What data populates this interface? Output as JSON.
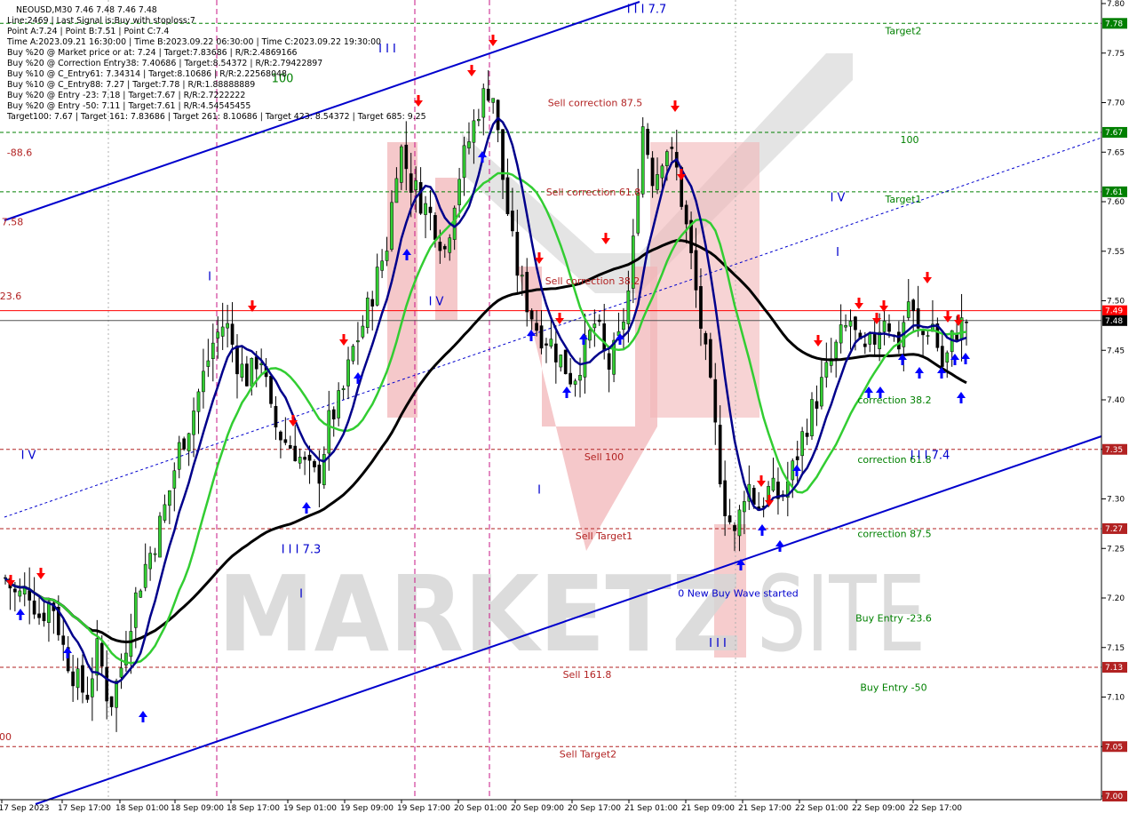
{
  "header": {
    "symbol_line": "NEOUSD,M30  7.46 7.48 7.46 7.48",
    "info_lines": [
      "Line:2469 | Last Signal is:Buy with stoploss:7",
      "Point A:7.24 | Point B:7.51 | Point C:7.4",
      "Time A:2023.09.21 16:30:00 | Time B:2023.09.22 06:30:00 | Time C:2023.09.22 19:30:00",
      "Buy %20 @ Market price or at: 7.24 | Target:7.83686 | R/R:2.4869166",
      "Buy %20 @ Correction Entry38: 7.40686 | Target:8.54372 | R/R:2.79422897",
      "Buy %10 @ C_Entry61: 7.34314 | Target:8.10686 | R/R:2.22568048",
      "Buy %10 @ C_Entry88: 7.27 | Target:7.78 | R/R:1.88888889",
      "Buy %20 @ Entry -23: 7.18 | Target:7.67 | R/R:2.7222222",
      "Buy %20 @ Entry -50: 7.11 | Target:7.61 | R/R:4.54545455",
      "Target100: 7.67 | Target 161: 7.83686 | Target 261: 8.10686 | Target 423: 8.54372 | Target 685: 9.25"
    ]
  },
  "watermark": {
    "text": "MARKETZ",
    "text2": "SITE"
  },
  "colors": {
    "buy": "#0000ff",
    "sell": "#ff0000",
    "green_level": "#008000",
    "red_level": "#b22222",
    "ma_fast": "#00008b",
    "ma_mid": "#32cd32",
    "ma_slow": "#000000",
    "price_tag": "#ff0000",
    "channel": "#0000cd"
  },
  "chart_data": {
    "type": "candlestick",
    "symbol": "NEOUSD",
    "timeframe": "M30",
    "ylim": [
      7.0,
      7.8
    ],
    "x_labels": [
      "17 Sep 2023",
      "17 Sep 17:00",
      "18 Sep 01:00",
      "18 Sep 09:00",
      "18 Sep 17:00",
      "19 Sep 01:00",
      "19 Sep 09:00",
      "19 Sep 17:00",
      "20 Sep 01:00",
      "20 Sep 09:00",
      "20 Sep 17:00",
      "21 Sep 01:00",
      "21 Sep 09:00",
      "21 Sep 17:00",
      "22 Sep 01:00",
      "22 Sep 09:00",
      "22 Sep 17:00"
    ],
    "y_ticks": [
      "7.80",
      "7.75",
      "7.70",
      "7.65",
      "7.60",
      "7.55",
      "7.50",
      "7.45",
      "7.40",
      "7.35",
      "7.30",
      "7.25",
      "7.20",
      "7.15",
      "7.10",
      "7.05",
      "7.00"
    ],
    "price_tags": [
      {
        "text": "7.78",
        "price": 7.78,
        "color": "#008000"
      },
      {
        "text": "7.67",
        "price": 7.67,
        "color": "#008000"
      },
      {
        "text": "7.61",
        "price": 7.61,
        "color": "#008000"
      },
      {
        "text": "7.49",
        "price": 7.49,
        "color": "#ff0000"
      },
      {
        "text": "7.48",
        "price": 7.48,
        "color": "#000000"
      },
      {
        "text": "7.35",
        "price": 7.35,
        "color": "#b22222"
      },
      {
        "text": "7.27",
        "price": 7.27,
        "color": "#b22222"
      },
      {
        "text": "7.13",
        "price": 7.13,
        "color": "#b22222"
      },
      {
        "text": "7.05",
        "price": 7.05,
        "color": "#b22222"
      },
      {
        "text": "7.00",
        "price": 7.0,
        "color": "#b22222"
      }
    ],
    "levels": [
      {
        "price": 7.78,
        "color": "#008000",
        "label": "Target2"
      },
      {
        "price": 7.67,
        "color": "#008000",
        "label": "100"
      },
      {
        "price": 7.61,
        "color": "#008000",
        "label": "Target1"
      },
      {
        "price": 7.35,
        "color": "#b22222",
        "label": "Sell 100"
      },
      {
        "price": 7.27,
        "color": "#b22222",
        "label": "Sell Target1"
      },
      {
        "price": 7.13,
        "color": "#b22222",
        "label": "Sell 161.8"
      },
      {
        "price": 7.05,
        "color": "#b22222",
        "label": "Sell Target2"
      }
    ],
    "level_texts": [
      {
        "text": "Sell correction 87.5",
        "price": 7.7,
        "color": "#b22222"
      },
      {
        "text": "Sell correction 61.8",
        "price": 7.61,
        "color": "#b22222"
      },
      {
        "text": "Sell correction 38.2",
        "price": 7.52,
        "color": "#b22222"
      },
      {
        "text": "correction 38.2",
        "price": 7.4,
        "color": "#008000"
      },
      {
        "text": "correction 61.8",
        "price": 7.34,
        "color": "#008000"
      },
      {
        "text": "correction 87.5",
        "price": 7.265,
        "color": "#008000"
      },
      {
        "text": "Buy Entry -23.6",
        "price": 7.18,
        "color": "#008000"
      },
      {
        "text": "Buy Entry -50",
        "price": 7.11,
        "color": "#008000"
      },
      {
        "text": "0 New Buy Wave started",
        "price": 7.205,
        "color": "#0000cd"
      },
      {
        "text": "-88.6",
        "price": 7.65,
        "color": "#b22222"
      },
      {
        "text": "7.58",
        "price": 7.58,
        "color": "#b22222"
      },
      {
        "text": "23.6",
        "price": 7.505,
        "color": "#b22222"
      },
      {
        "text": "00",
        "price": 7.06,
        "color": "#b22222"
      }
    ],
    "wave_labels": [
      {
        "text": "I I I",
        "price": 7.755
      },
      {
        "text": "I V",
        "price": 7.605
      },
      {
        "text": "I",
        "price": 7.55
      },
      {
        "text": "I",
        "price": 7.525
      },
      {
        "text": "I V",
        "price": 7.5
      },
      {
        "text": "I V",
        "price": 7.345
      },
      {
        "text": "I I I 7.4",
        "price": 7.345
      },
      {
        "text": "I I I 7.3",
        "price": 7.25
      },
      {
        "text": "I",
        "price": 7.31
      },
      {
        "text": "I",
        "price": 7.205
      },
      {
        "text": "I I I",
        "price": 7.155
      },
      {
        "text": "I I I 7.7",
        "price": 7.795
      },
      {
        "text": "100",
        "price": 7.725
      }
    ],
    "series": [
      {
        "name": "NEOUSD",
        "close_path": [
          7.22,
          7.2,
          7.21,
          7.18,
          7.2,
          7.15,
          7.12,
          7.1,
          7.15,
          7.09,
          7.13,
          7.19,
          7.23,
          7.26,
          7.3,
          7.35,
          7.38,
          7.42,
          7.46,
          7.48,
          7.44,
          7.42,
          7.45,
          7.38,
          7.36,
          7.35,
          7.33,
          7.32,
          7.38,
          7.4,
          7.45,
          7.48,
          7.52,
          7.56,
          7.66,
          7.62,
          7.6,
          7.58,
          7.55,
          7.62,
          7.66,
          7.7,
          7.72,
          7.62,
          7.54,
          7.5,
          7.47,
          7.46,
          7.44,
          7.42,
          7.45,
          7.48,
          7.43,
          7.46,
          7.52,
          7.68,
          7.62,
          7.66,
          7.63,
          7.56,
          7.48,
          7.4,
          7.3,
          7.26,
          7.32,
          7.29,
          7.31,
          7.3,
          7.33,
          7.37,
          7.4,
          7.43,
          7.46,
          7.48,
          7.44,
          7.46,
          7.49,
          7.45,
          7.5,
          7.46,
          7.48,
          7.43,
          7.47,
          7.48
        ]
      }
    ]
  }
}
